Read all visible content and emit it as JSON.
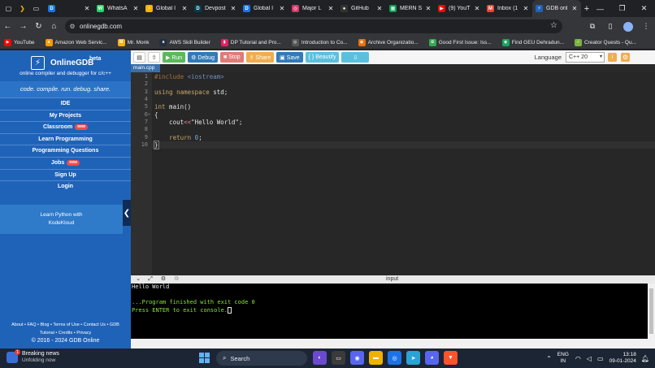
{
  "browser": {
    "tabs": [
      {
        "title": "",
        "favicon": "D",
        "color": "#1a73e8"
      },
      {
        "title": "WhatsA",
        "favicon": "W",
        "color": "#25d366"
      },
      {
        "title": "Global I",
        "favicon": "⚡",
        "color": "#f4b400"
      },
      {
        "title": "Devpost",
        "favicon": "D",
        "color": "#003e54"
      },
      {
        "title": "Global I",
        "favicon": "D",
        "color": "#1a73e8"
      },
      {
        "title": "Major L",
        "favicon": "◎",
        "color": "#e1306c"
      },
      {
        "title": "GitHub",
        "favicon": "●",
        "color": "#333333"
      },
      {
        "title": "MERN S",
        "favicon": "▦",
        "color": "#0f9d58"
      },
      {
        "title": "(9) YouT",
        "favicon": "▶",
        "color": "#ff0000"
      },
      {
        "title": "Inbox (1",
        "favicon": "M",
        "color": "#ea4335"
      },
      {
        "title": "GDB onl",
        "favicon": "⚡",
        "color": "#1f63b9"
      }
    ],
    "url": "onlinegdb.com",
    "bookmarks": [
      {
        "label": "YouTube",
        "icon": "▶",
        "color": "#ff0000"
      },
      {
        "label": "Amazon Web Servic...",
        "icon": "a",
        "color": "#ff9900"
      },
      {
        "label": "Mr. Monk",
        "icon": "M",
        "color": "#f4b400"
      },
      {
        "label": "AWS Skill Builder",
        "icon": "a",
        "color": "#232f3e"
      },
      {
        "label": "DP Tutorial and Pro...",
        "icon": "▮",
        "color": "#e91e63"
      },
      {
        "label": "Introduction to Co...",
        "icon": "◎",
        "color": "#555555"
      },
      {
        "label": "Archive Organizatio...",
        "icon": "◉",
        "color": "#e8710a"
      },
      {
        "label": "Good First Issue: Iss...",
        "icon": "✿",
        "color": "#34a853"
      },
      {
        "label": "Find GEU Dehradun...",
        "icon": "◉",
        "color": "#1aa260"
      },
      {
        "label": "Creator Quests - Qu...",
        "icon": "✓",
        "color": "#7cb342"
      }
    ]
  },
  "sidebar": {
    "brand": "OnlineGDB",
    "beta": "beta",
    "tagline": "online compiler and debugger for c/c++",
    "slogan": "code. compile. run. debug. share.",
    "items": [
      {
        "label": "IDE",
        "new": ""
      },
      {
        "label": "My Projects",
        "new": ""
      },
      {
        "label": "Classroom",
        "new": "new"
      },
      {
        "label": "Learn Programming",
        "new": ""
      },
      {
        "label": "Programming Questions",
        "new": ""
      },
      {
        "label": "Jobs",
        "new": "new"
      },
      {
        "label": "Sign Up",
        "new": ""
      },
      {
        "label": "Login",
        "new": ""
      }
    ],
    "promo_line1": "Learn Python with",
    "promo_line2": "KodeKloud",
    "footer_line1": "About • FAQ • Blog • Terms of Use • Contact Us • GDB",
    "footer_line2": "Tutorial • Credits • Privacy",
    "copyright": "© 2016 - 2024 GDB Online"
  },
  "toolbar": {
    "run": "▶ Run",
    "debug": "⚙ Debug",
    "stop": "■ Stop",
    "share": "⇪ Share",
    "save": "▣ Save",
    "beautify": "{ } Beautify",
    "download": "⇩",
    "language_label": "Language",
    "language_value": "C++ 20"
  },
  "editor": {
    "file_tab": "main.cpp",
    "lines": [
      "1",
      "2",
      "3",
      "4",
      "5",
      "6",
      "7",
      "8",
      "9",
      "10"
    ]
  },
  "console": {
    "label": "input",
    "output": "Hello World",
    "finished": "...Program finished with exit code 0",
    "press_enter": "Press ENTER to exit console."
  },
  "taskbar": {
    "news_title": "Breaking news",
    "news_sub": "Unfolding now",
    "news_badge": "1",
    "search": "Search",
    "lang_top": "ENG",
    "lang_bottom": "IN",
    "time": "13:18",
    "date": "09-01-2024"
  }
}
